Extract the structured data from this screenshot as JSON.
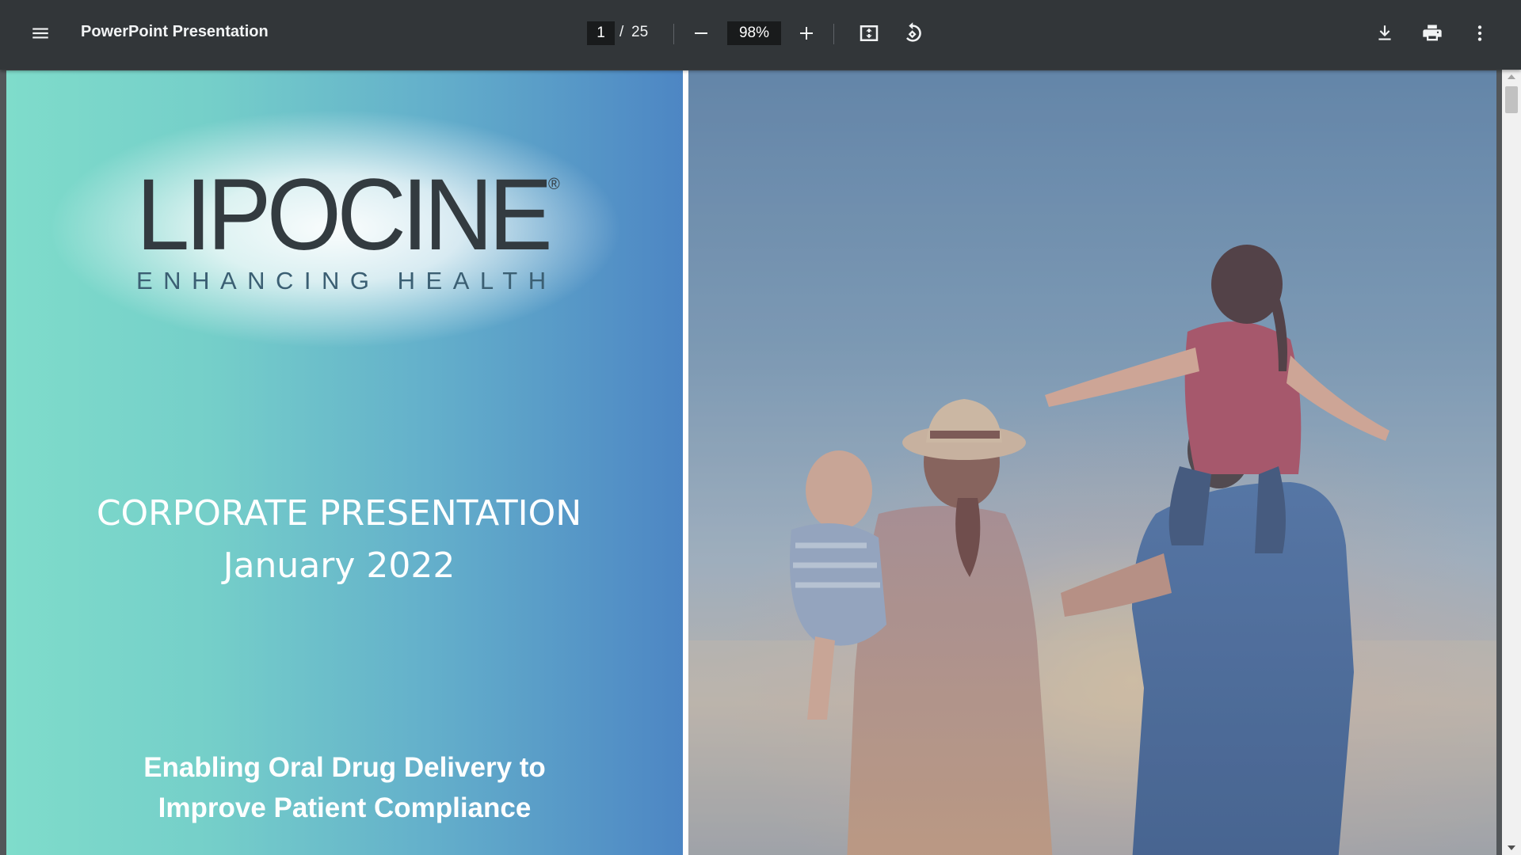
{
  "toolbar": {
    "title": "PowerPoint Presentation",
    "current_page": "1",
    "page_separator": "/",
    "total_pages": "25",
    "zoom": "98%",
    "icons": {
      "menu": "menu-icon",
      "zoom_out": "minus-icon",
      "zoom_in": "plus-icon",
      "fit": "fit-to-page-icon",
      "rotate": "rotate-counterclockwise-icon",
      "download": "download-icon",
      "print": "print-icon",
      "more": "more-vertical-icon"
    }
  },
  "slide": {
    "logo_text": "LIPOCINE",
    "logo_registered": "®",
    "logo_tagline": "ENHANCING HEALTH",
    "title_line1": "CORPORATE PRESENTATION",
    "title_line2": "January 2022",
    "tagline_line1": "Enabling Oral Drug Delivery to",
    "tagline_line2": "Improve Patient Compliance",
    "colors": {
      "teal": "#7fdccb",
      "blue": "#4d86c4",
      "logo_dark": "#333b40",
      "logo_tag": "#3b5f73"
    }
  }
}
